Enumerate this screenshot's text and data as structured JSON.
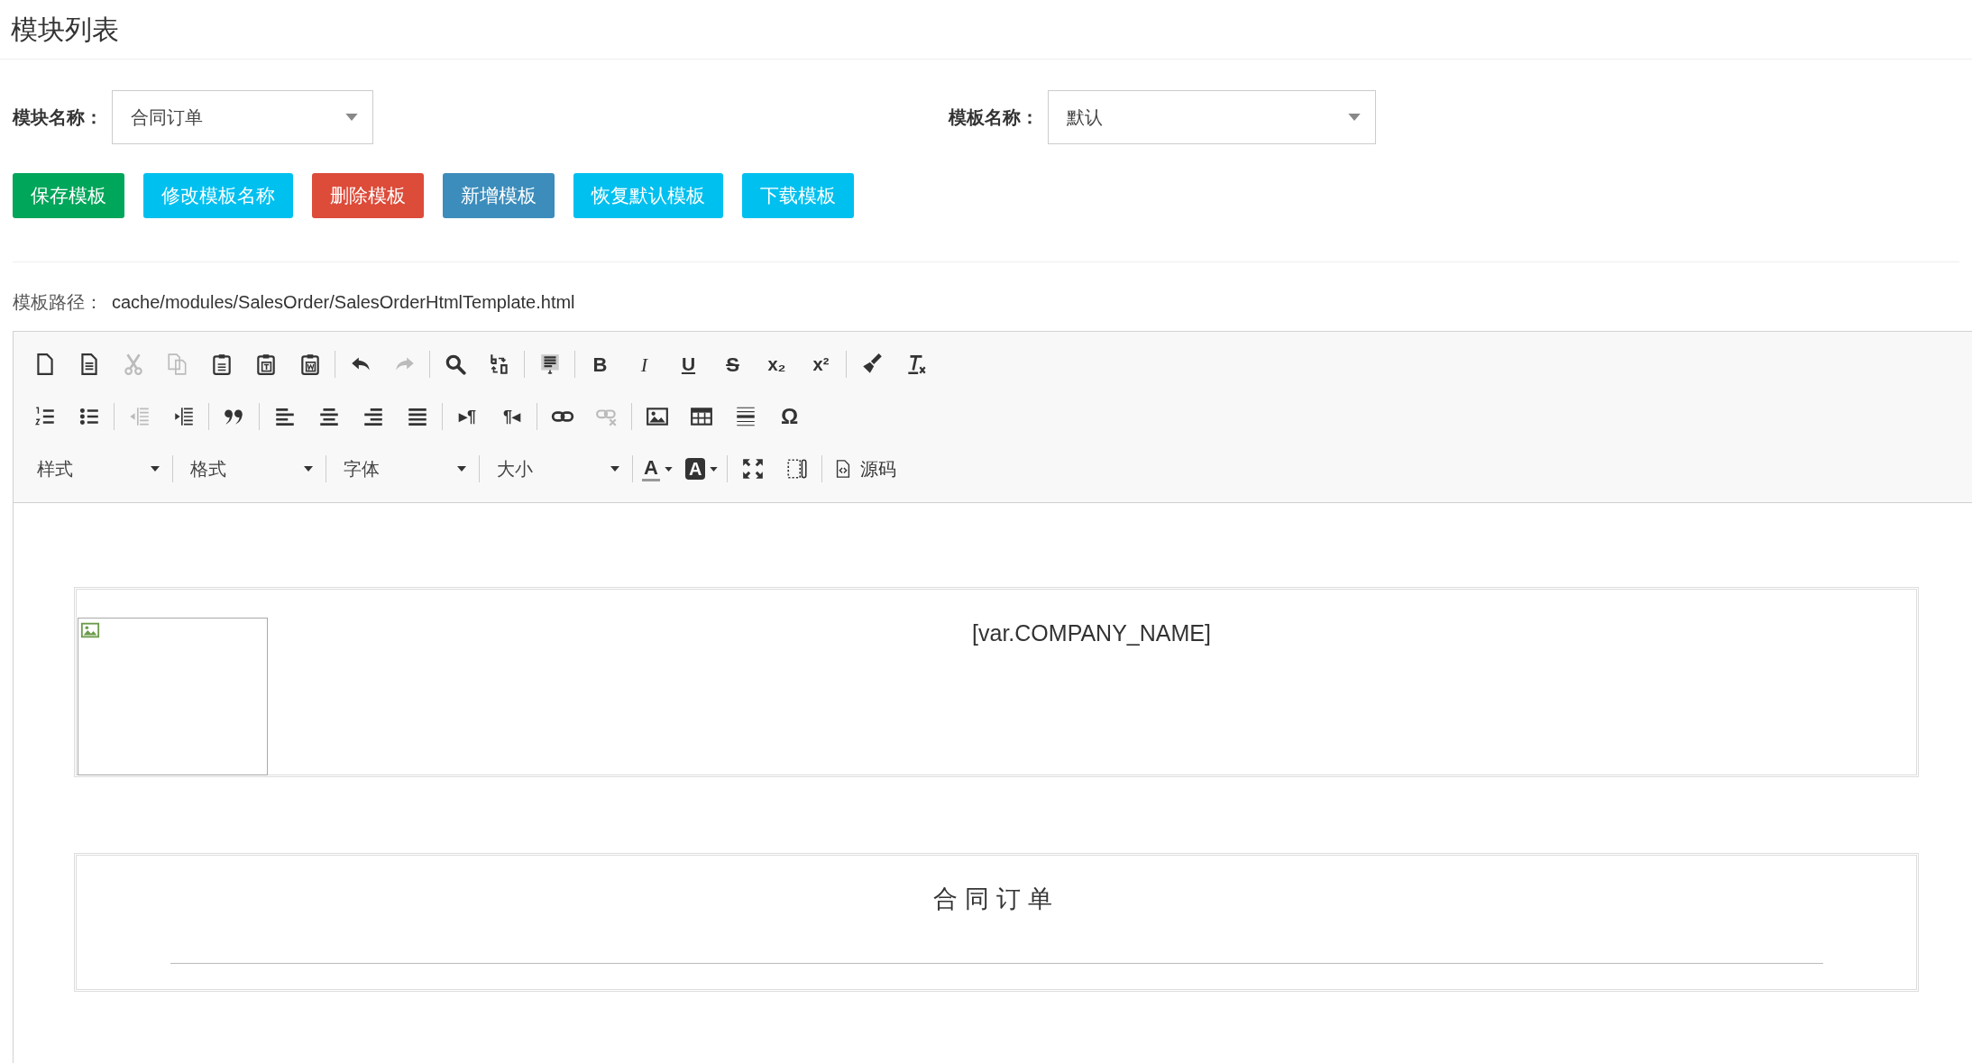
{
  "page_title": "模块列表",
  "filters": [
    {
      "label": "模块名称：",
      "value": "合同订单"
    },
    {
      "label": "模板名称：",
      "value": "默认"
    }
  ],
  "buttons": [
    {
      "label": "保存模板",
      "color": "#00a65a"
    },
    {
      "label": "修改模板名称",
      "color": "#00c0ef"
    },
    {
      "label": "删除模板",
      "color": "#dd4b39"
    },
    {
      "label": "新增模板",
      "color": "#3c8dbc"
    },
    {
      "label": "恢复默认模板",
      "color": "#00c0ef"
    },
    {
      "label": "下载模板",
      "color": "#00c0ef"
    }
  ],
  "template_path": {
    "label": "模板路径：",
    "value": "cache/modules/SalesOrder/SalesOrderHtmlTemplate.html"
  },
  "toolbar": {
    "rows": [
      {
        "groups": [
          {
            "items": [
              {
                "kind": "newpage",
                "disabled": false
              },
              {
                "kind": "preview",
                "disabled": false
              },
              {
                "kind": "cut",
                "disabled": true
              },
              {
                "kind": "copy",
                "disabled": true
              },
              {
                "kind": "paste",
                "disabled": false
              },
              {
                "kind": "pastetext",
                "disabled": false
              },
              {
                "kind": "pasteword",
                "disabled": false
              }
            ]
          },
          {
            "items": [
              {
                "kind": "undo",
                "disabled": false
              },
              {
                "kind": "redo",
                "disabled": true
              }
            ]
          },
          {
            "items": [
              {
                "kind": "find",
                "disabled": false
              },
              {
                "kind": "replace",
                "disabled": false
              }
            ]
          },
          {
            "items": [
              {
                "kind": "selectall",
                "disabled": false
              }
            ]
          },
          {
            "items": [
              {
                "kind": "bold",
                "label": "B",
                "disabled": false
              },
              {
                "kind": "italic",
                "label": "I",
                "disabled": false
              },
              {
                "kind": "underline",
                "label": "U",
                "disabled": false
              },
              {
                "kind": "strike",
                "label": "S",
                "disabled": false
              },
              {
                "kind": "subscript",
                "label": "x₂",
                "disabled": false
              },
              {
                "kind": "superscript",
                "label": "x²",
                "disabled": false
              }
            ]
          },
          {
            "items": [
              {
                "kind": "copyformat",
                "disabled": false
              },
              {
                "kind": "removeformat",
                "disabled": false
              }
            ]
          }
        ]
      },
      {
        "groups": [
          {
            "items": [
              {
                "kind": "numlist",
                "disabled": false
              },
              {
                "kind": "bulletlist",
                "disabled": false
              }
            ]
          },
          {
            "items": [
              {
                "kind": "outdent",
                "disabled": true
              },
              {
                "kind": "indent",
                "disabled": false
              }
            ]
          },
          {
            "items": [
              {
                "kind": "blockquote",
                "disabled": false
              }
            ]
          },
          {
            "items": [
              {
                "kind": "alignleft",
                "disabled": false
              },
              {
                "kind": "aligncenter",
                "disabled": false
              },
              {
                "kind": "alignright",
                "disabled": false
              },
              {
                "kind": "justify",
                "disabled": false
              }
            ]
          },
          {
            "items": [
              {
                "kind": "ltr",
                "label": "▸¶",
                "disabled": false
              },
              {
                "kind": "rtl",
                "label": "¶◂",
                "disabled": false
              }
            ]
          },
          {
            "items": [
              {
                "kind": "link",
                "disabled": false
              },
              {
                "kind": "unlink",
                "disabled": true
              }
            ]
          },
          {
            "items": [
              {
                "kind": "image",
                "disabled": false
              },
              {
                "kind": "table",
                "disabled": false
              },
              {
                "kind": "hr",
                "disabled": false
              },
              {
                "kind": "specialchar",
                "label": "Ω",
                "disabled": false
              }
            ]
          }
        ]
      },
      {
        "groups": [
          {
            "items": [
              {
                "kind": "combo",
                "label": "样式"
              }
            ]
          },
          {
            "items": [
              {
                "kind": "combo",
                "label": "格式"
              }
            ]
          },
          {
            "items": [
              {
                "kind": "combo",
                "label": "字体"
              }
            ]
          },
          {
            "items": [
              {
                "kind": "combo",
                "label": "大小"
              }
            ]
          },
          {
            "items": [
              {
                "kind": "textcolor",
                "label": "A",
                "disabled": false
              },
              {
                "kind": "bgcolor",
                "label": "A",
                "disabled": false
              }
            ]
          },
          {
            "items": [
              {
                "kind": "maximize",
                "disabled": false
              },
              {
                "kind": "showblocks",
                "disabled": false
              }
            ]
          },
          {
            "items": [
              {
                "kind": "source",
                "label": "源码",
                "disabled": false
              }
            ]
          }
        ]
      }
    ]
  },
  "document": {
    "company_name": "[var.COMPANY_NAME]",
    "title": "合同订单"
  }
}
